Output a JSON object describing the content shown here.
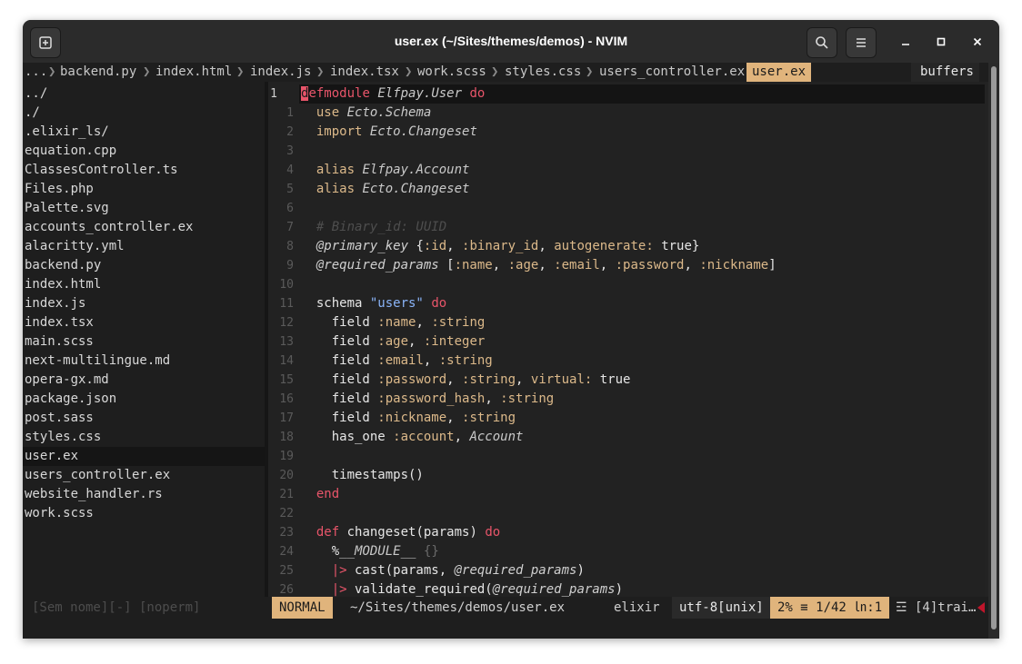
{
  "window": {
    "title": "user.ex (~/Sites/themes/demos) - NVIM",
    "new_tab_icon": "new-tab-icon",
    "search_icon": "search-icon",
    "menu_icon": "hamburger-menu-icon",
    "minimize_icon": "minimize-icon",
    "maximize_icon": "maximize-icon",
    "close_icon": "close-icon"
  },
  "tabline": {
    "overflow": "...",
    "tabs": [
      "backend.py",
      "index.html",
      "index.js",
      "index.tsx",
      "work.scss",
      "styles.css",
      "users_controller.ex"
    ],
    "active": "user.ex",
    "buffers_label": "buffers"
  },
  "file_tree": {
    "items": [
      "../",
      "./",
      ".elixir_ls/",
      "equation.cpp",
      "ClassesController.ts",
      "Files.php",
      "Palette.svg",
      "accounts_controller.ex",
      "alacritty.yml",
      "backend.py",
      "index.html",
      "index.js",
      "index.tsx",
      "main.scss",
      "next-multilingue.md",
      "opera-gx.md",
      "package.json",
      "post.sass",
      "styles.css",
      "user.ex",
      "users_controller.ex",
      "website_handler.rs",
      "work.scss"
    ],
    "selected": "user.ex"
  },
  "editor": {
    "line_numbers": [
      "1",
      "1",
      "2",
      "3",
      "4",
      "5",
      "6",
      "7",
      "8",
      "9",
      "10",
      "11",
      "12",
      "13",
      "14",
      "15",
      "16",
      "17",
      "18",
      "19",
      "20",
      "21",
      "22",
      "23",
      "24",
      "25",
      "26"
    ],
    "lines": [
      "defmodule Elfpay.User do",
      "  use Ecto.Schema",
      "  import Ecto.Changeset",
      "",
      "  alias Elfpay.Account",
      "  alias Ecto.Changeset",
      "",
      "  # Binary_id: UUID",
      "  @primary_key {:id, :binary_id, autogenerate: true}",
      "  @required_params [:name, :age, :email, :password, :nickname]",
      "",
      "  schema \"users\" do",
      "    field :name, :string",
      "    field :age, :integer",
      "    field :email, :string",
      "    field :password, :string, virtual: true",
      "    field :password_hash, :string",
      "    field :nickname, :string",
      "    has_one :account, Account",
      "",
      "    timestamps()",
      "  end",
      "",
      "  def changeset(params) do",
      "    %__MODULE__ {}",
      "    |> cast(params, @required_params)",
      "    |> validate_required(@required_params)"
    ]
  },
  "statusline": {
    "tree_status": "[Sem nome][-] [noperm]",
    "mode": "NORMAL",
    "path": "~/Sites/themes/demos/user.ex",
    "filetype": "elixir",
    "encoding": "utf-8[unix]",
    "position": "2% ≡ 1/42 ㏑:1",
    "trailing": "☲ [4]trai…"
  },
  "colors": {
    "accent": "#e0b47c",
    "keyword": "#e8556a",
    "string": "#8ab4f8",
    "background": "#232323"
  }
}
